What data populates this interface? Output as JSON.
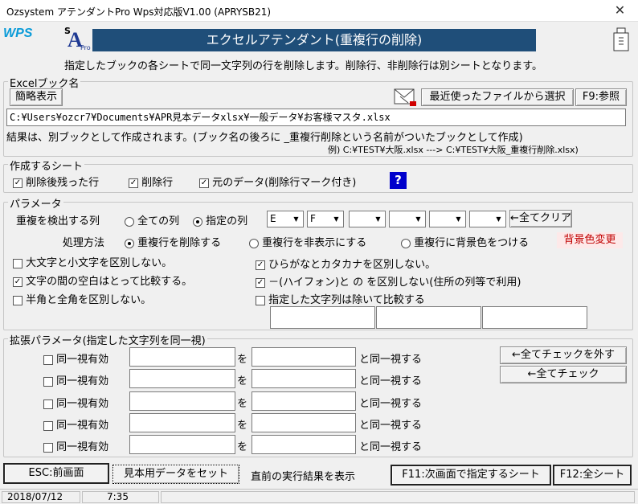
{
  "window": {
    "title": "Ozsystem アテンダントPro Wps対応版V1.00 (APRYSB21)",
    "close": "✕"
  },
  "logo": {
    "wps": "WPS",
    "letter_s": "S",
    "letter_a": "A",
    "pro": "Pro"
  },
  "header": {
    "title": "エクセルアテンダント(重複行の削除)",
    "description": "指定したブックの各シートで同一文字列の行を削除します。削除行、非削除行は別シートとなります。"
  },
  "excel_book": {
    "legend": "Excelブック名",
    "simple_display_btn": "簡略表示",
    "recent_files_btn": "最近使ったファイルから選択",
    "browse_btn": "F9:参照",
    "path_value": "C:¥Users¥ozcr7¥Documents¥APR見本データxlsx¥一般データ¥お客様マスタ.xlsx",
    "result_note": "結果は、別ブックとして作成されます。(ブック名の後ろに _重複行削除という名前がついたブックとして作成)",
    "example": "例) C:¥TEST¥大阪.xlsx ---> C:¥TEST¥大阪_重複行削除.xlsx)"
  },
  "sheets": {
    "legend": "作成するシート",
    "remaining": {
      "label": "削除後残った行",
      "checked": true
    },
    "deleted": {
      "label": "削除行",
      "checked": true
    },
    "original": {
      "label": "元のデータ(削除行マーク付き)",
      "checked": true
    },
    "help": "?"
  },
  "params": {
    "legend": "パラメータ",
    "detect_label": "重複を検出する列",
    "all_cols": "全ての列",
    "specified_cols": "指定の列",
    "col_selects": [
      "E",
      "F",
      "",
      "",
      "",
      ""
    ],
    "clear_btn": "←全てクリア",
    "method_label": "処理方法",
    "method_delete": "重複行を削除する",
    "method_hide": "重複行を非表示にする",
    "method_color": "重複行に背景色をつける",
    "bg_change": "背景色変更",
    "opt_case": {
      "label": "大文字と小文字を区別しない。",
      "checked": false
    },
    "opt_space": {
      "label": "文字の間の空白はとって比較する。",
      "checked": true
    },
    "opt_width": {
      "label": "半角と全角を区別しない。",
      "checked": false
    },
    "opt_kana": {
      "label": "ひらがなとカタカナを区別しない。",
      "checked": true
    },
    "opt_hyphen": {
      "label": "－(ハイフォン)と の を区別しない(住所の列等で利用)",
      "checked": true
    },
    "opt_exclude": {
      "label": "指定した文字列は除いて比較する",
      "checked": false
    }
  },
  "ext": {
    "legend": "拡張パラメータ(指定した文字列を同一視)",
    "rows": [
      {
        "label": "同一視有効",
        "wo": "を",
        "suffix": "と同一視する"
      },
      {
        "label": "同一視有効",
        "wo": "を",
        "suffix": "と同一視する"
      },
      {
        "label": "同一視有効",
        "wo": "を",
        "suffix": "と同一視する"
      },
      {
        "label": "同一視有効",
        "wo": "を",
        "suffix": "と同一視する"
      },
      {
        "label": "同一視有効",
        "wo": "を",
        "suffix": "と同一視する"
      }
    ],
    "uncheck_all_btn": "←全てチェックを外す",
    "check_all_btn": "←全てチェック"
  },
  "footer": {
    "esc_btn": "ESC:前画面",
    "sample_btn": "見本用データをセット",
    "prev_result": "直前の実行結果を表示",
    "f11_btn": "F11:次画面で指定するシート",
    "f12_btn": "F12:全シート"
  },
  "status": {
    "date": "2018/07/12",
    "time": "7:35"
  },
  "colors": {
    "header_bg": "#1f4e79",
    "accent_red": "#c00000",
    "help_bg": "#0000cc"
  }
}
